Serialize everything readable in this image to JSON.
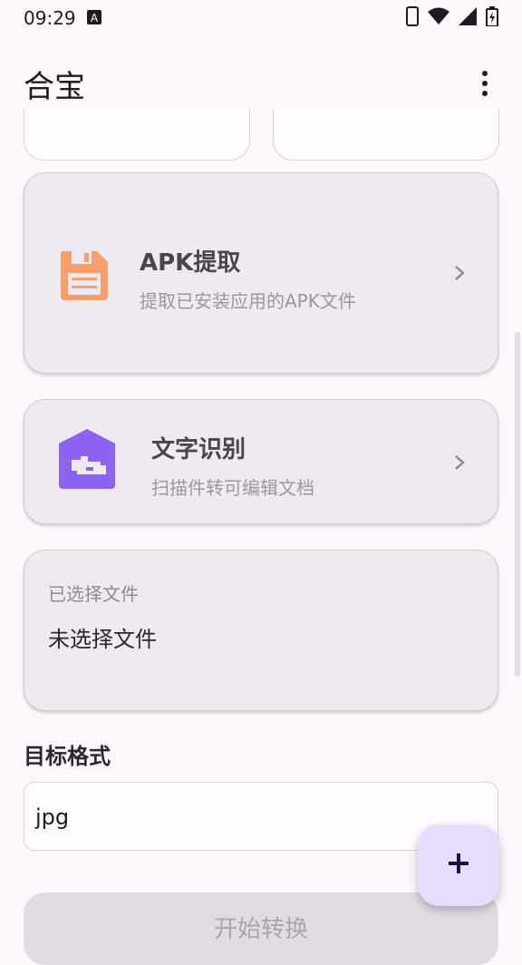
{
  "status_bar": {
    "time": "09:29",
    "icons": [
      "notification-a-icon",
      "phone-icon",
      "wifi-icon",
      "signal-icon",
      "battery-charging-icon"
    ]
  },
  "app_bar": {
    "title": "合宝",
    "menu_icon": "more-vert-icon"
  },
  "cards": [
    {
      "title": "APK提取",
      "subtitle": "提取已安装应用的APK文件",
      "icon": "save-file-icon",
      "icon_color": "#f5a06a"
    },
    {
      "title": "文字识别",
      "subtitle": "扫描件转可编辑文档",
      "icon": "scan-house-icon",
      "icon_color": "#8b63f0"
    }
  ],
  "selected_file": {
    "label": "已选择文件",
    "value": "未选择文件"
  },
  "target_format": {
    "label": "目标格式",
    "value": "jpg"
  },
  "fab": {
    "icon": "plus-icon"
  },
  "start_button": {
    "label": "开始转换"
  },
  "colors": {
    "background": "#fdf7fb",
    "card": "#efe9f1",
    "fab": "#e8ddff",
    "accent": "#1d0f4a"
  }
}
